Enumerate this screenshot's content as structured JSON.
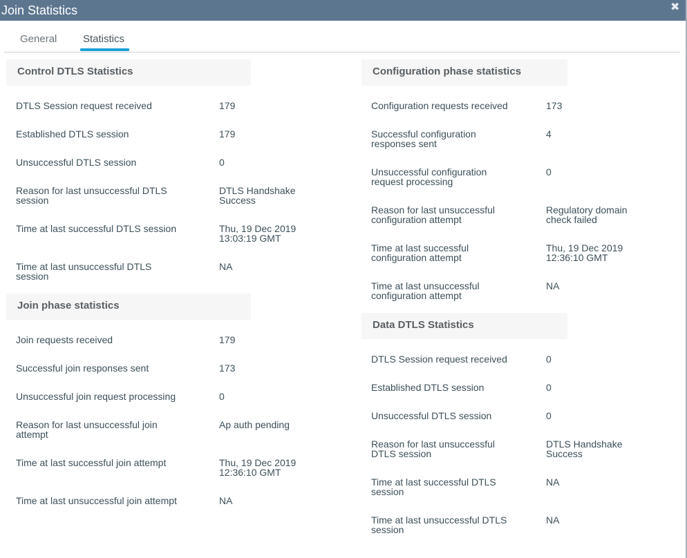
{
  "dialog": {
    "title": "Join Statistics",
    "close_icon": "close-x-icon"
  },
  "tabs": [
    {
      "label": "General",
      "active": false
    },
    {
      "label": "Statistics",
      "active": true
    }
  ],
  "accent_color": "#1ba0d7",
  "header_color": "#5d7690",
  "sections": {
    "control_dtls": {
      "title": "Control DTLS Statistics",
      "rows": [
        {
          "label": "DTLS Session request received",
          "value": "179"
        },
        {
          "label": "Established DTLS session",
          "value": "179"
        },
        {
          "label": "Unsuccessful DTLS session",
          "value": "0"
        },
        {
          "label": "Reason for last unsuccessful DTLS session",
          "value": "DTLS Handshake Success"
        },
        {
          "label": "Time at last successful DTLS session",
          "value": "Thu, 19 Dec 2019 13:03:19 GMT"
        },
        {
          "label": "Time at last unsuccessful DTLS session",
          "value": "NA"
        }
      ]
    },
    "join_phase": {
      "title": "Join phase statistics",
      "rows": [
        {
          "label": "Join requests received",
          "value": "179"
        },
        {
          "label": "Successful join responses sent",
          "value": "173"
        },
        {
          "label": "Unsuccessful join request processing",
          "value": "0"
        },
        {
          "label": "Reason for last unsuccessful join attempt",
          "value": "Ap auth pending"
        },
        {
          "label": "Time at last successful join attempt",
          "value": "Thu, 19 Dec 2019 12:36:10 GMT"
        },
        {
          "label": "Time at last unsuccessful join attempt",
          "value": "NA"
        }
      ]
    },
    "configuration_phase": {
      "title": "Configuration phase statistics",
      "rows": [
        {
          "label": "Configuration requests received",
          "value": "173"
        },
        {
          "label": "Successful configuration responses sent",
          "value": "4"
        },
        {
          "label": "Unsuccessful configuration request processing",
          "value": "0"
        },
        {
          "label": "Reason for last unsuccessful configuration attempt",
          "value": "Regulatory domain check failed"
        },
        {
          "label": "Time at last successful configuration attempt",
          "value": "Thu, 19 Dec 2019 12:36:10 GMT"
        },
        {
          "label": "Time at last unsuccessful configuration attempt",
          "value": "NA"
        }
      ]
    },
    "data_dtls": {
      "title": "Data DTLS Statistics",
      "rows": [
        {
          "label": "DTLS Session request received",
          "value": "0"
        },
        {
          "label": "Established DTLS session",
          "value": "0"
        },
        {
          "label": "Unsuccessful DTLS session",
          "value": "0"
        },
        {
          "label": "Reason for last unsuccessful DTLS session",
          "value": "DTLS Handshake Success"
        },
        {
          "label": "Time at last successful DTLS session",
          "value": "NA"
        },
        {
          "label": "Time at last unsuccessful DTLS session",
          "value": "NA"
        }
      ]
    }
  }
}
